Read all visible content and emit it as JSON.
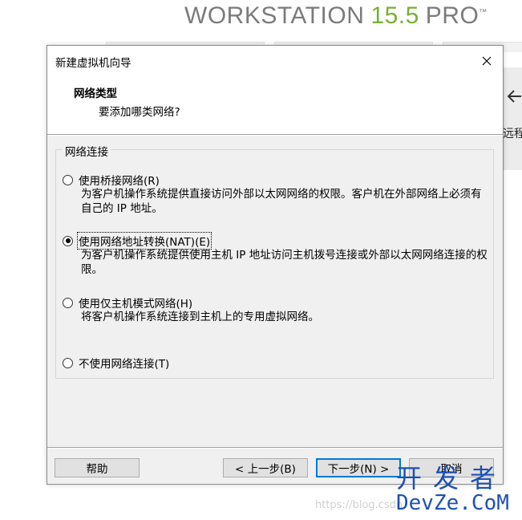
{
  "background": {
    "brand_name": "WORKSTATION",
    "brand_version": "15.5",
    "brand_edition": "PRO",
    "brand_tm": "™",
    "remote_label": "远程"
  },
  "dialog": {
    "title": "新建虚拟机向导",
    "header_title": "网络类型",
    "header_subtitle": "要添加哪类网络?",
    "group_label": "网络连接",
    "options": [
      {
        "label": "使用桥接网络(R)",
        "description": "为客户机操作系统提供直接访问外部以太网网络的权限。客户机在外部网络上必须有自己的 IP 地址。",
        "checked": false
      },
      {
        "label": "使用网络地址转换(NAT)(E)",
        "description": "为客户机操作系统提供使用主机 IP 地址访问主机拨号连接或外部以太网网络连接的权限。",
        "checked": true
      },
      {
        "label": "使用仅主机模式网络(H)",
        "description": "将客户机操作系统连接到主机上的专用虚拟网络。",
        "checked": false
      },
      {
        "label": "不使用网络连接(T)",
        "description": "",
        "checked": false
      }
    ],
    "buttons": {
      "help": "帮助",
      "back": "< 上一步(B)",
      "next": "下一步(N) >",
      "cancel": "取消"
    }
  },
  "watermark": {
    "url": "https://blog.csdn",
    "logo_cn": "开发者",
    "logo_en": "DevZe.CoM"
  },
  "colors": {
    "brand_green": "#79b12f",
    "focus_blue": "#0078d7",
    "watermark_blue": "#1e50b4"
  }
}
